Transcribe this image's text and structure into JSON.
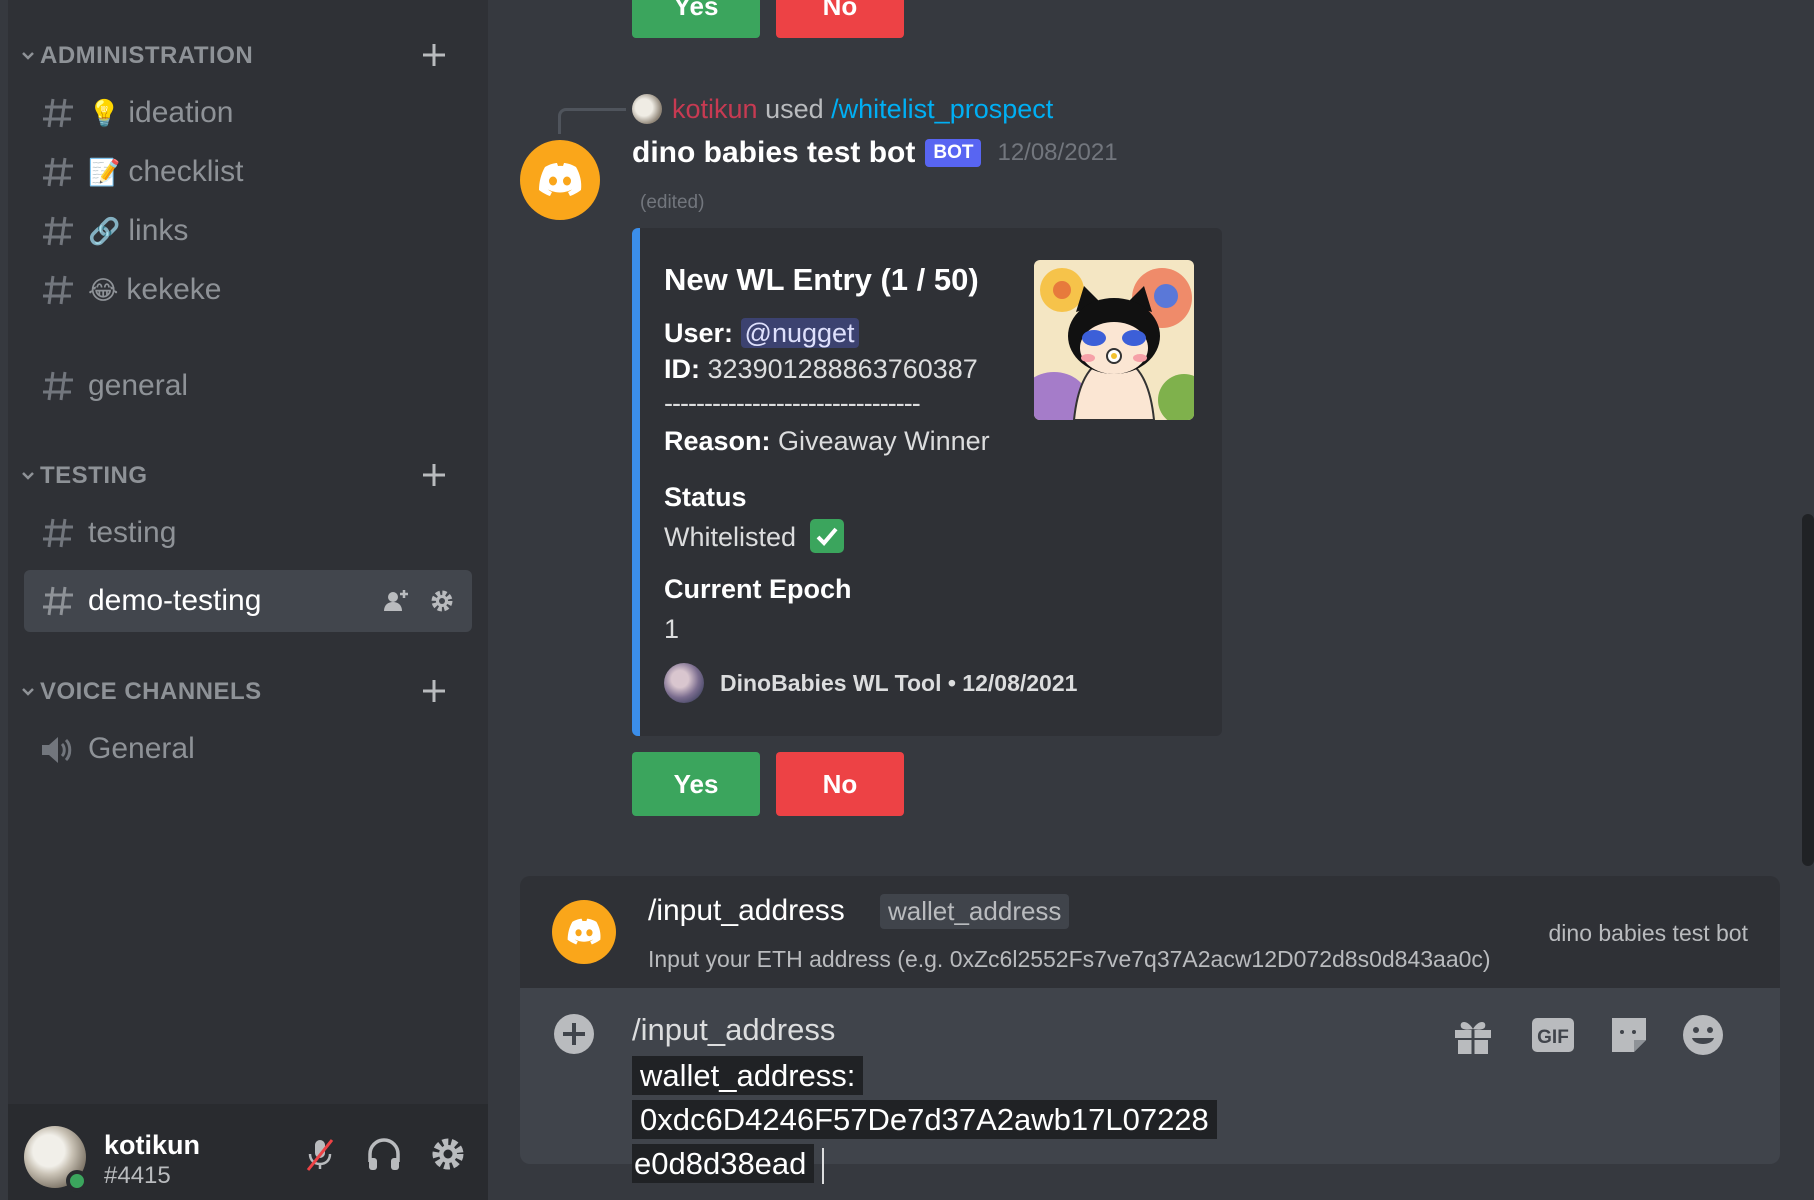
{
  "sidebar": {
    "categories": [
      {
        "label": "ADMINISTRATION"
      },
      {
        "label": "TESTING"
      },
      {
        "label": "VOICE CHANNELS"
      }
    ],
    "channels": [
      {
        "emoji": "💡",
        "label": "ideation"
      },
      {
        "emoji": "📝",
        "label": "checklist"
      },
      {
        "emoji": "🔗",
        "label": "links"
      },
      {
        "emoji": "😂",
        "label": "kekeke"
      },
      {
        "emoji": "",
        "label": "general"
      },
      {
        "emoji": "",
        "label": "testing"
      },
      {
        "emoji": "",
        "label": "demo-testing"
      }
    ],
    "voice_channels": [
      {
        "label": "General"
      }
    ],
    "user": {
      "name": "kotikun",
      "tag": "#4415",
      "status_color": "#3ba55d"
    }
  },
  "top_buttons": {
    "yes": "Yes",
    "no": "No"
  },
  "message": {
    "reply": {
      "user": "kotikun",
      "used": "used",
      "command": "/whitelist_prospect"
    },
    "author": "dino babies test bot",
    "bot_tag": "BOT",
    "timestamp": "12/08/2021",
    "edited": "(edited)",
    "embed": {
      "accent_color": "#3b8eea",
      "title": "New WL Entry (1 / 50)",
      "user_label": "User:",
      "user_mention": "@nugget",
      "id_label": "ID:",
      "id_value": "323901288863760387",
      "divider": "--------------------------------",
      "reason_label": "Reason:",
      "reason_value": "Giveaway Winner",
      "status_label": "Status",
      "status_value": "Whitelisted",
      "status_icon": "check-mark-icon",
      "epoch_label": "Current Epoch",
      "epoch_value": "1",
      "footer": "DinoBabies WL Tool • 12/08/2021"
    },
    "buttons": {
      "yes": "Yes",
      "no": "No"
    }
  },
  "autocomplete": {
    "command": "/input_address",
    "option": "wallet_address",
    "description": "Input your ETH address (e.g. 0xZc6l2552Fs7ve7q37A2acw12D072d8s0d843aa0c)",
    "source": "dino babies test bot"
  },
  "chat_input": {
    "command": "/input_address",
    "value_line1": "wallet_address: 0xdc6D4246F57De7d37A2awb17L07228",
    "value_line2": "e0d8d38ead"
  },
  "colors": {
    "yes": "#3ba55d",
    "no": "#ed4245",
    "bot_tag": "#5865f2",
    "bot_avatar": "#faa61a"
  }
}
